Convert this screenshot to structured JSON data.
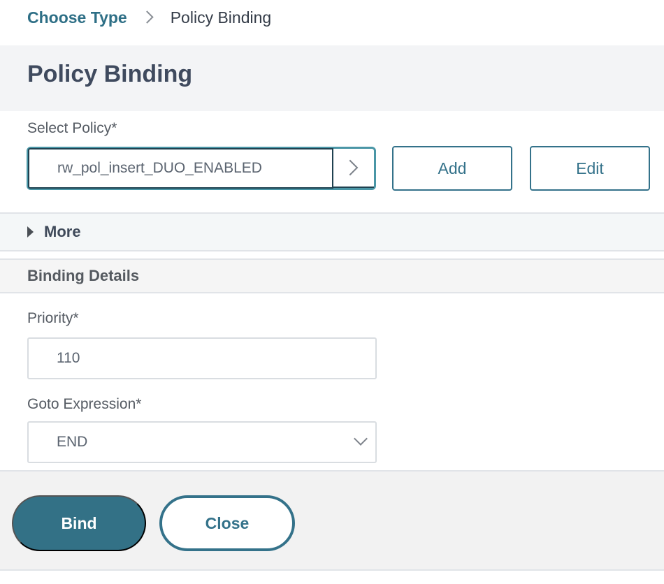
{
  "breadcrumb": {
    "items": [
      {
        "label": "Choose Type",
        "link": true
      },
      {
        "label": "Policy Binding",
        "link": false
      }
    ]
  },
  "page": {
    "title": "Policy Binding"
  },
  "select_policy": {
    "label": "Select Policy*",
    "value": "rw_pol_insert_DUO_ENABLED",
    "add_label": "Add",
    "edit_label": "Edit"
  },
  "more": {
    "label": "More",
    "expanded": false
  },
  "binding_details": {
    "title": "Binding Details",
    "priority": {
      "label": "Priority*",
      "value": "110"
    },
    "goto_expression": {
      "label": "Goto Expression*",
      "value": "END"
    }
  },
  "footer": {
    "bind_label": "Bind",
    "close_label": "Close"
  },
  "colors": {
    "accent": "#337186",
    "link": "#2e6f86",
    "focus_border": "#4a96a6"
  }
}
